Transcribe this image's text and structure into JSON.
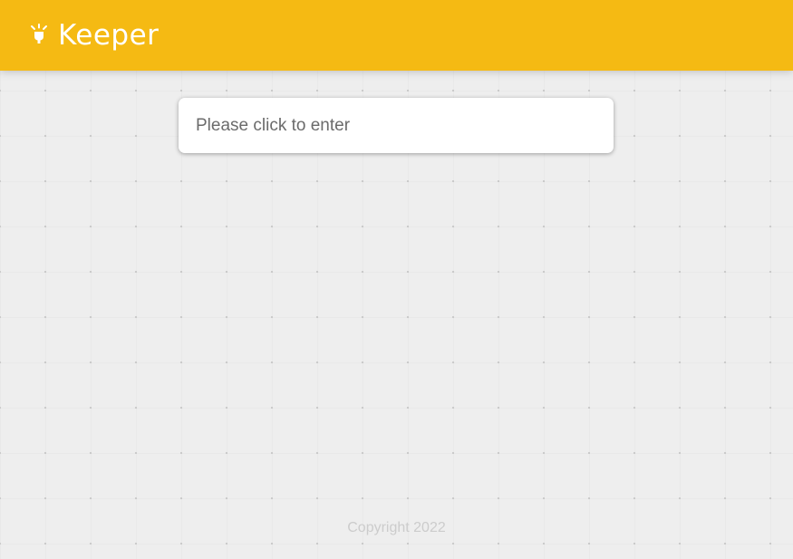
{
  "header": {
    "title": "Keeper",
    "logo_icon": "lightbulb-icon",
    "background_color": "#f5ba13"
  },
  "note_input": {
    "placeholder": "Please click to enter",
    "value": ""
  },
  "footer": {
    "copyright": "Copyright 2022"
  }
}
